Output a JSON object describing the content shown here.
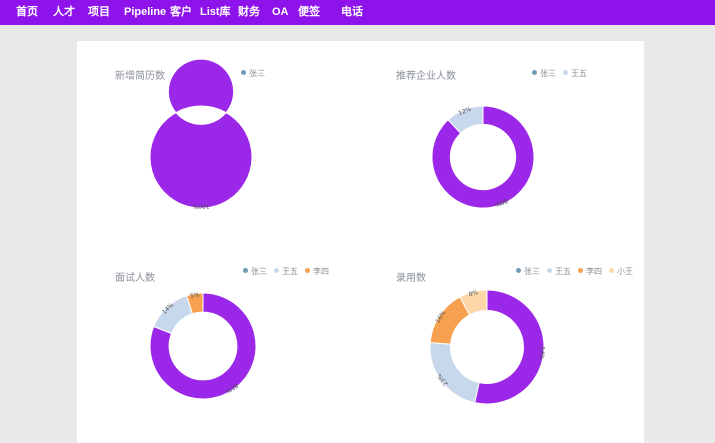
{
  "nav": {
    "items": [
      "首页",
      "人才",
      "项目",
      "Pipeline",
      "客户",
      "List库",
      "财务",
      "OA",
      "便签",
      "电话"
    ]
  },
  "colors": {
    "nav_bg": "#8e12ea",
    "series": {
      "张三": "#6f9bb5",
      "王五": "#c8d8ec",
      "李四": "#f7a04f",
      "小王": "#fdd7a8"
    },
    "slice": {
      "张三": "#9b27e8",
      "王五": "#c8d8ec",
      "李四": "#f7a04f",
      "小王": "#fdd7a8"
    }
  },
  "chart_data": [
    {
      "type": "pie",
      "title": "新增简历数",
      "legend": [
        "张三"
      ],
      "legend_position": "top-right",
      "categories": [
        "张三"
      ],
      "values": [
        100
      ],
      "labels": [
        "100%"
      ]
    },
    {
      "type": "pie",
      "title": "推荐企业人数",
      "legend": [
        "张三",
        "王五"
      ],
      "legend_position": "top-right",
      "categories": [
        "张三",
        "王五"
      ],
      "values": [
        88,
        12
      ],
      "labels": [
        "88%",
        "12%"
      ]
    },
    {
      "type": "pie",
      "title": "面试人数",
      "legend": [
        "张三",
        "王五",
        "李四"
      ],
      "legend_position": "top-right",
      "categories": [
        "张三",
        "王五",
        "李四"
      ],
      "values": [
        81,
        14,
        5
      ],
      "labels": [
        "81%",
        "14%",
        "5%"
      ]
    },
    {
      "type": "pie",
      "title": "录用数",
      "legend": [
        "张三",
        "王五",
        "李四",
        "小王"
      ],
      "legend_position": "top-right",
      "categories": [
        "张三",
        "王五",
        "李四",
        "小王"
      ],
      "values": [
        54,
        23,
        16,
        8
      ],
      "labels": [
        "54%",
        "23%",
        "16%",
        "8%"
      ]
    }
  ]
}
